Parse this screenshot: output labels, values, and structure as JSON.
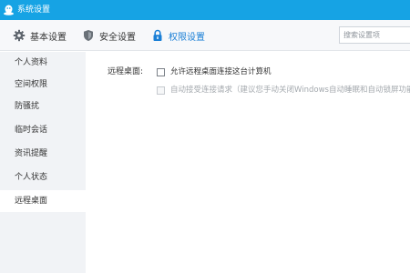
{
  "window": {
    "title": "系统设置"
  },
  "toolbar": {
    "tabs": [
      {
        "label": "基本设置",
        "icon": "gear-icon"
      },
      {
        "label": "安全设置",
        "icon": "shield-icon"
      },
      {
        "label": "权限设置",
        "icon": "lock-icon",
        "active": true
      }
    ],
    "search_placeholder": "搜索设置项"
  },
  "sidebar": {
    "items": [
      {
        "label": "个人资料"
      },
      {
        "label": "空间权限"
      },
      {
        "label": "防骚扰"
      },
      {
        "label": "临时会话"
      },
      {
        "label": "资讯提醒"
      },
      {
        "label": "个人状态"
      },
      {
        "label": "远程桌面",
        "active": true
      }
    ]
  },
  "content": {
    "section_label": "远程桌面:",
    "options": [
      {
        "label": "允许远程桌面连接这台计算机",
        "checked": false,
        "enabled": true
      },
      {
        "label": "自动接受连接请求（建议您手动关闭Windows自动睡眠和自动锁屏功能",
        "checked": false,
        "enabled": false
      }
    ]
  },
  "colors": {
    "titlebar": "#16a3e4",
    "accent": "#1a7fd6",
    "sidebar_bg": "#f1f3f6",
    "toolbar_bg": "#f7f8fa"
  }
}
